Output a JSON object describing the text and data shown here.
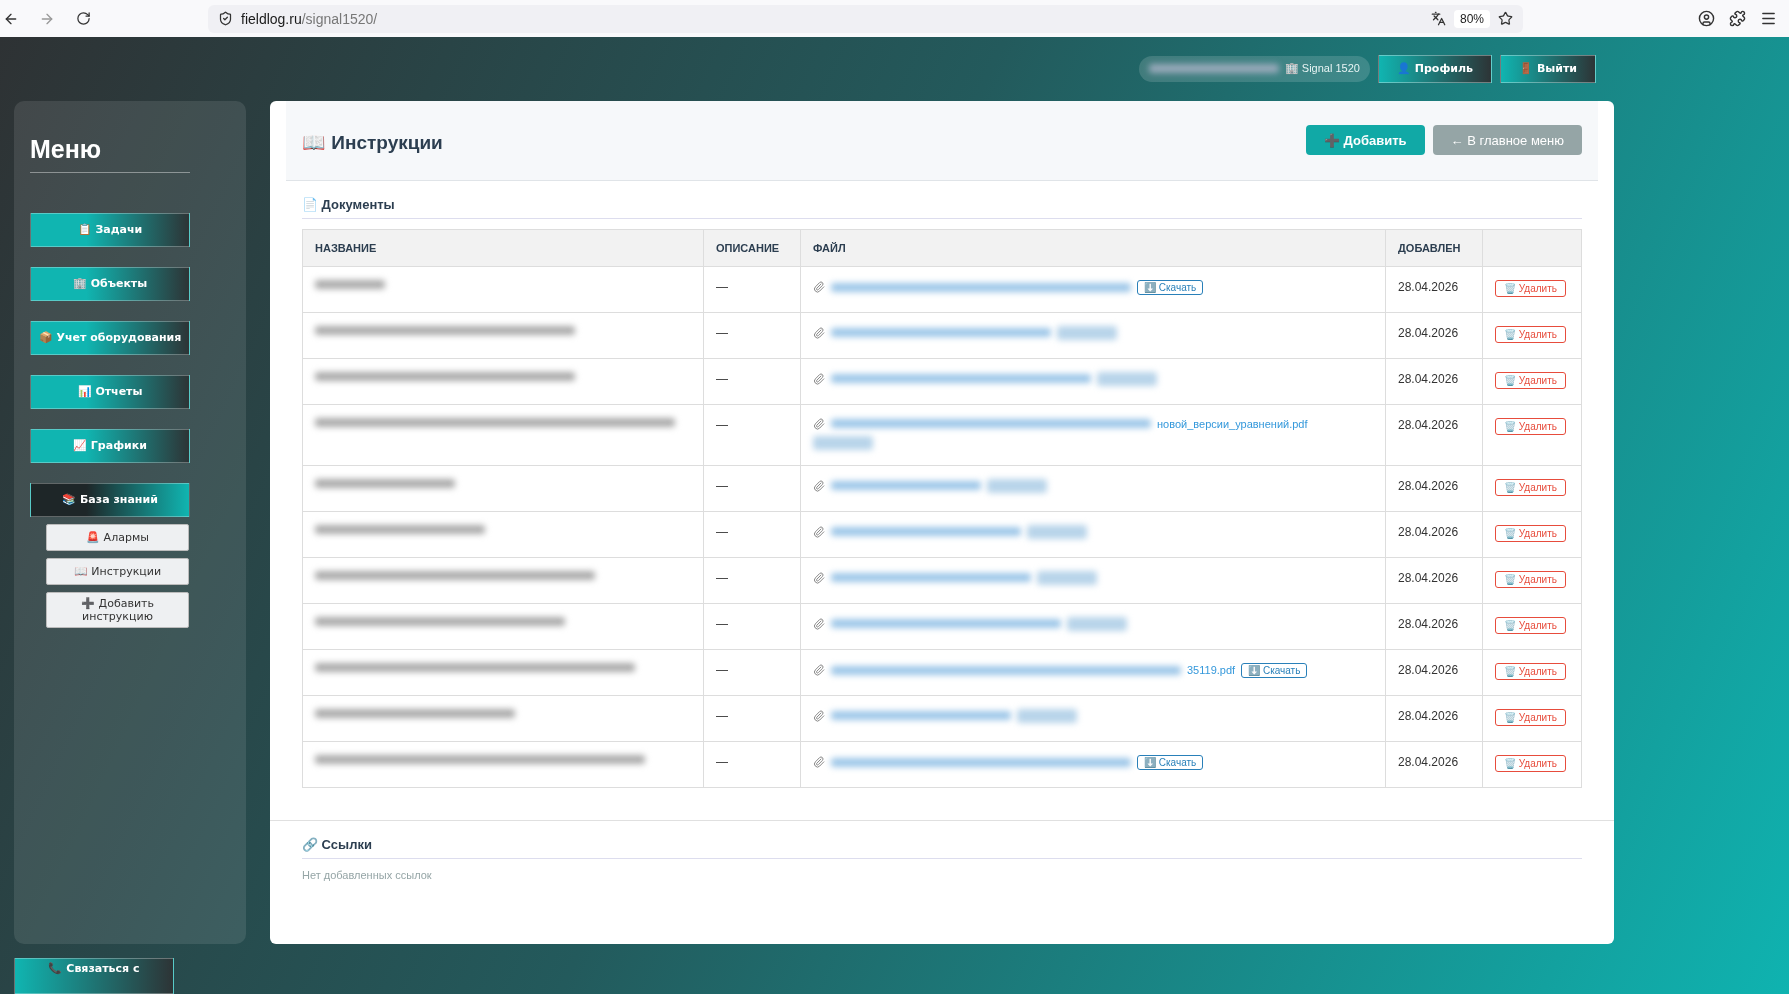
{
  "browser": {
    "host": "fieldlog.ru",
    "path": "/signal1520/",
    "zoom": "80%"
  },
  "topbar": {
    "site": "🏢 Signal 1520",
    "buttons": [
      {
        "label": "👤 Профиль"
      },
      {
        "label": "🚪 Выйти"
      }
    ]
  },
  "sidebar": {
    "title": "Меню",
    "items": [
      {
        "label": "📋 Задачи",
        "selected": false
      },
      {
        "label": "🏢 Объекты",
        "selected": false
      },
      {
        "label": "📦 Учет оборудования",
        "selected": false
      },
      {
        "label": "📊 Отчеты",
        "selected": false
      },
      {
        "label": "📈 Графики",
        "selected": false
      },
      {
        "label": "📚 База знаний",
        "selected": true,
        "children": [
          {
            "label": "🚨 Алармы"
          },
          {
            "label": "📖 Инструкции"
          },
          {
            "label": "➕ Добавить инструкцию"
          }
        ]
      }
    ],
    "contact": "📞 Связаться с"
  },
  "page": {
    "title": "📖 Инструкции",
    "buttons": [
      {
        "kind": "primary",
        "label": "➕ Добавить"
      },
      {
        "kind": "secondary",
        "label": "← В главное меню"
      }
    ]
  },
  "documents": {
    "heading": "📄 Документы",
    "columns": [
      "НАЗВАНИЕ",
      "ОПИСАНИЕ",
      "ФАЙЛ",
      "ДОБАВЛЕН"
    ],
    "rows": [
      {
        "description": "—",
        "download": "⬇️ Скачать",
        "added": "28.04.2026",
        "action": "🗑️ Удалить"
      },
      {
        "description": "—",
        "added": "28.04.2026",
        "action": "🗑️ Удалить"
      },
      {
        "description": "—",
        "added": "28.04.2026",
        "action": "🗑️ Удалить"
      },
      {
        "description": "—",
        "file_end": "новой_версии_уравнений.pdf",
        "added": "28.04.2026",
        "action": "🗑️ Удалить"
      },
      {
        "description": "—",
        "added": "28.04.2026",
        "action": "🗑️ Удалить"
      },
      {
        "description": "—",
        "added": "28.04.2026",
        "action": "🗑️ Удалить"
      },
      {
        "description": "—",
        "added": "28.04.2026",
        "action": "🗑️ Удалить"
      },
      {
        "description": "—",
        "added": "28.04.2026",
        "action": "🗑️ Удалить"
      },
      {
        "description": "—",
        "file_end": "35119.pdf",
        "download": "⬇️ Скачать",
        "added": "28.04.2026",
        "action": "🗑️ Удалить"
      },
      {
        "description": "—",
        "added": "28.04.2026",
        "action": "🗑️ Удалить"
      },
      {
        "description": "—",
        "download": "⬇️ Скачать",
        "added": "28.04.2026",
        "action": "🗑️ Удалить"
      }
    ]
  },
  "links": {
    "heading": "🔗 Ссылки",
    "empty": "Нет добавленных ссылок"
  }
}
